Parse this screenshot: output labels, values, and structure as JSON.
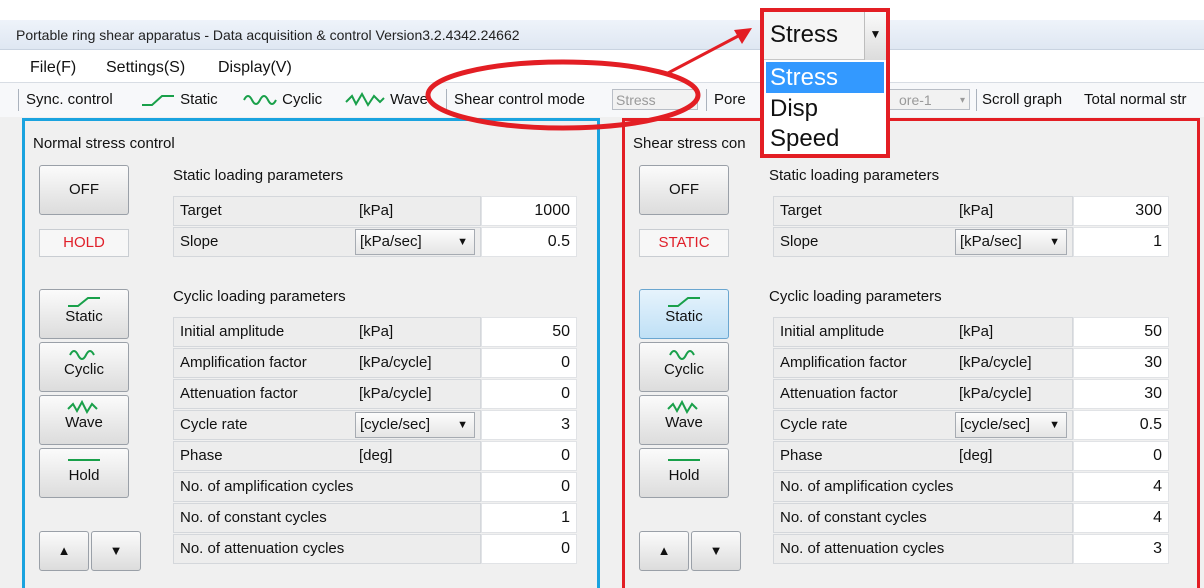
{
  "window": {
    "title": "Portable ring shear apparatus - Data acquisition & control Version3.2.4342.24662"
  },
  "menu": [
    "File(F)",
    "Settings(S)",
    "Display(V)"
  ],
  "toolbar": {
    "sync_label": "Sync. control",
    "static_label": "Static",
    "cyclic_label": "Cyclic",
    "wave_label": "Wave",
    "shear_mode_label": "Shear control mode",
    "shear_mode_value": "Stress",
    "pore_label": "Pore",
    "pore_value": "ore-1",
    "scroll_graph_label": "Scroll graph",
    "total_normal_label": "Total normal str"
  },
  "dropdown_callout": {
    "selected": "Stress",
    "options": [
      "Stress",
      "Disp",
      "Speed"
    ],
    "highlighted_index": 0
  },
  "normal": {
    "title": "Normal stress control",
    "off_label": "OFF",
    "status": "HOLD",
    "static_title": "Static loading parameters",
    "static_rows": [
      {
        "label": "Target",
        "unit": "[kPa]",
        "value": "1000"
      },
      {
        "label": "Slope",
        "unit": "[kPa/sec]",
        "value": "0.5"
      }
    ],
    "cyclic_title": "Cyclic loading parameters",
    "cyclic_rows": [
      {
        "label": "Initial amplitude",
        "unit": "[kPa]",
        "value": "50"
      },
      {
        "label": "Amplification factor",
        "unit": "[kPa/cycle]",
        "value": "0"
      },
      {
        "label": "Attenuation factor",
        "unit": "[kPa/cycle]",
        "value": "0"
      },
      {
        "label": "Cycle rate",
        "unit": "[cycle/sec]",
        "value": "3"
      },
      {
        "label": "Phase",
        "unit": "[deg]",
        "value": "0"
      },
      {
        "label": "No. of amplification cycles",
        "unit": "",
        "value": "0"
      },
      {
        "label": "No. of constant cycles",
        "unit": "",
        "value": "1"
      },
      {
        "label": "No. of attenuation cycles",
        "unit": "",
        "value": "0"
      }
    ],
    "mode_buttons": [
      "Static",
      "Cyclic",
      "Wave",
      "Hold"
    ]
  },
  "shear": {
    "title": "Shear stress con",
    "off_label": "OFF",
    "status": "STATIC",
    "static_title": "Static loading parameters",
    "static_rows": [
      {
        "label": "Target",
        "unit": "[kPa]",
        "value": "300"
      },
      {
        "label": "Slope",
        "unit": "[kPa/sec]",
        "value": "1"
      }
    ],
    "cyclic_title": "Cyclic loading parameters",
    "cyclic_rows": [
      {
        "label": "Initial amplitude",
        "unit": "[kPa]",
        "value": "50"
      },
      {
        "label": "Amplification factor",
        "unit": "[kPa/cycle]",
        "value": "30"
      },
      {
        "label": "Attenuation factor",
        "unit": "[kPa/cycle]",
        "value": "30"
      },
      {
        "label": "Cycle rate",
        "unit": "[cycle/sec]",
        "value": "0.5"
      },
      {
        "label": "Phase",
        "unit": "[deg]",
        "value": "0"
      },
      {
        "label": "No. of amplification cycles",
        "unit": "",
        "value": "4"
      },
      {
        "label": "No. of constant cycles",
        "unit": "",
        "value": "4"
      },
      {
        "label": "No. of attenuation cycles",
        "unit": "",
        "value": "3"
      }
    ],
    "mode_buttons": [
      "Static",
      "Cyclic",
      "Wave",
      "Hold"
    ]
  },
  "colors": {
    "highlight_red": "#e31e24",
    "panel_blue": "#1aa3df",
    "icon_green": "#19a04a",
    "selection_blue": "#3399ff"
  }
}
